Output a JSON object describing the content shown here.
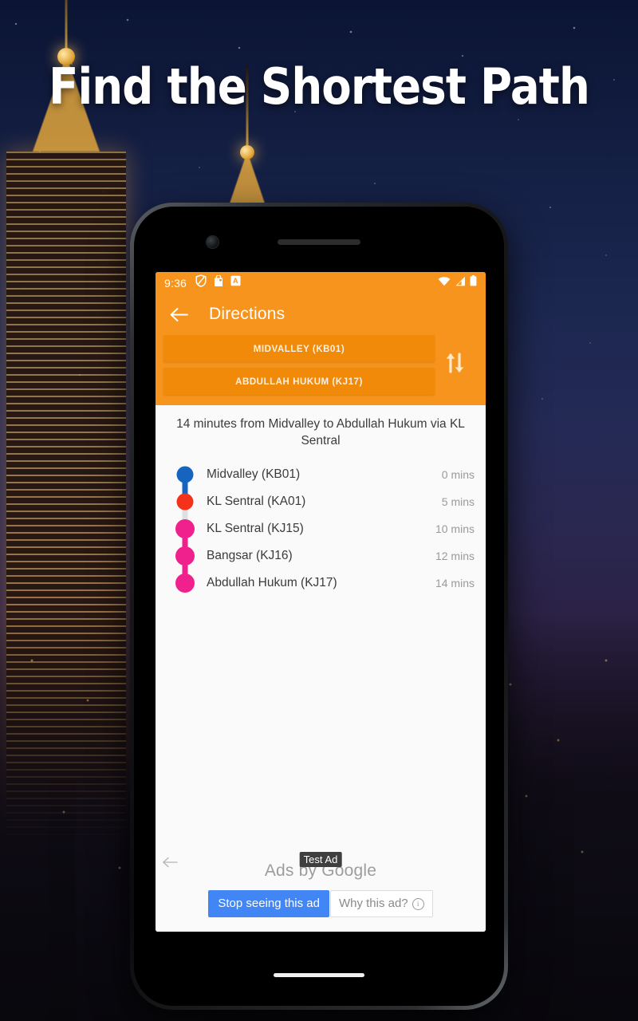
{
  "promo": {
    "headline": "Find the Shortest Path"
  },
  "status_bar": {
    "time": "9:36",
    "left_icons": [
      "do-not-disturb-shield-icon",
      "bag-icon",
      "a-badge-icon"
    ],
    "right_icons": [
      "wifi-icon",
      "signal-icon",
      "battery-icon"
    ]
  },
  "app_bar": {
    "back_icon": "back-arrow-icon",
    "title": "Directions",
    "origin": "MIDVALLEY (KB01)",
    "destination": "ABDULLAH HUKUM (KJ17)",
    "swap_icon": "swap-vertical-icon",
    "accent_color": "#F7941D",
    "field_color": "#F08A08"
  },
  "route": {
    "summary": "14 minutes from Midvalley to Abdullah Hukum via KL Sentral",
    "stops": [
      {
        "name": "Midvalley (KB01)",
        "time": "0 mins",
        "color": "#1565C0",
        "connector": "#1565C0"
      },
      {
        "name": "KL Sentral (KA01)",
        "time": "5 mins",
        "color": "#F4321C",
        "connector": "#E0E0E0"
      },
      {
        "name": "KL Sentral (KJ15)",
        "time": "10 mins",
        "color": "#F0208C",
        "connector": "#F0208C"
      },
      {
        "name": "Bangsar (KJ16)",
        "time": "12 mins",
        "color": "#F0208C",
        "connector": "#F0208C"
      },
      {
        "name": "Abdullah Hukum (KJ17)",
        "time": "14 mins",
        "color": "#F0208C",
        "connector": ""
      }
    ]
  },
  "ad": {
    "back_icon": "ad-back-arrow-icon",
    "badge": "Test Ad",
    "byline": "Ads by Google",
    "stop_label": "Stop seeing this ad",
    "why_label": "Why this ad?",
    "info_icon": "info-icon",
    "stop_color": "#4285F4"
  }
}
